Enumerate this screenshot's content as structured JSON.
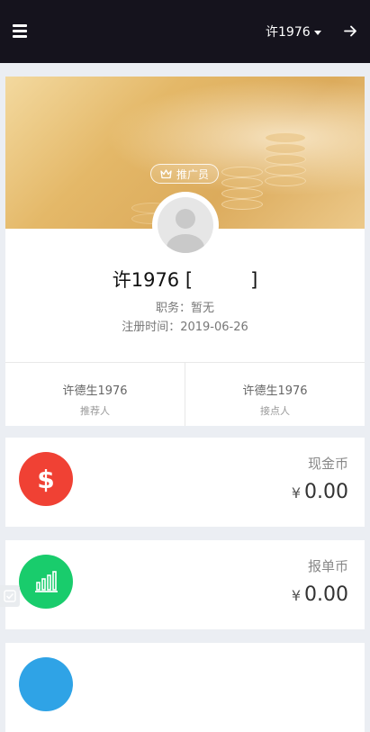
{
  "header": {
    "username": "许1976",
    "menu_icon": "hamburger-menu-icon",
    "dropdown_icon": "caret-down-icon",
    "logout_icon": "arrow-right-icon"
  },
  "profile": {
    "role_badge": "推广员",
    "role_badge_icon": "crown-icon",
    "name": "许1976",
    "name_open": "[",
    "name_close": "]",
    "position_label": "职务：",
    "position_value": "暂无",
    "register_label": "注册时间：",
    "register_value": "2019-06-26",
    "avatar_icon": "default-avatar-icon"
  },
  "relations": [
    {
      "name": "许德生1976",
      "role": "推荐人"
    },
    {
      "name": "许德生1976",
      "role": "接点人"
    }
  ],
  "wallets": [
    {
      "label": "现金币",
      "currency": "¥",
      "amount": "0.00",
      "icon": "dollar-icon",
      "color": "#f04134"
    },
    {
      "label": "报单币",
      "currency": "¥",
      "amount": "0.00",
      "icon": "bar-chart-icon",
      "color": "#19cc6c"
    },
    {
      "icon": "wallet-icon",
      "color": "#2fa3e6"
    }
  ],
  "colors": {
    "topbar": "#15131d",
    "page_bg": "#ebeef3",
    "accent_gold": "#dcab5c"
  }
}
